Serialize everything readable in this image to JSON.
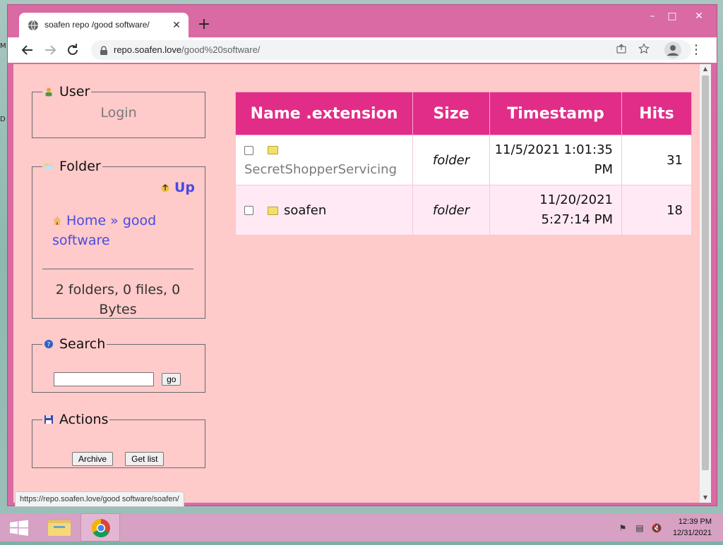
{
  "desktop": {
    "edge_text_1": "M",
    "edge_text_2": "D"
  },
  "browser": {
    "tab_title": "soafen repo /good software/",
    "tab_close": "✕",
    "new_tab": "+",
    "url_domain": "repo.soafen.love",
    "url_path": "/good%20software/",
    "window_controls": {
      "minimize": "–",
      "maximize": "□",
      "close": "✕"
    },
    "status_url": "https://repo.soafen.love/good software/soafen/"
  },
  "sidebar": {
    "user": {
      "title": "User",
      "login": "Login"
    },
    "folder": {
      "title": "Folder",
      "up": "Up",
      "breadcrumb_home": "Home",
      "breadcrumb_sep": "»",
      "breadcrumb_current": "good software",
      "summary": "2 folders, 0 files, 0 Bytes"
    },
    "search": {
      "title": "Search",
      "value": "",
      "go": "go"
    },
    "actions": {
      "title": "Actions",
      "archive": "Archive",
      "get_list": "Get list"
    }
  },
  "table": {
    "headers": {
      "name": "Name .extension",
      "size": "Size",
      "timestamp": "Timestamp",
      "hits": "Hits"
    },
    "rows": [
      {
        "name": "SecretShopperServicing",
        "size": "folder",
        "timestamp": "11/5/2021 1:01:35 PM",
        "hits": "31"
      },
      {
        "name": "soafen",
        "size": "folder",
        "timestamp": "11/20/2021 5:27:14 PM",
        "hits": "18"
      }
    ]
  },
  "taskbar": {
    "time": "12:39 PM",
    "date": "12/31/2021"
  },
  "colors": {
    "page_bg": "#ffcaca",
    "header_bg": "#e12d88",
    "window_frame": "#d96aa3",
    "link": "#4a4ae0"
  }
}
